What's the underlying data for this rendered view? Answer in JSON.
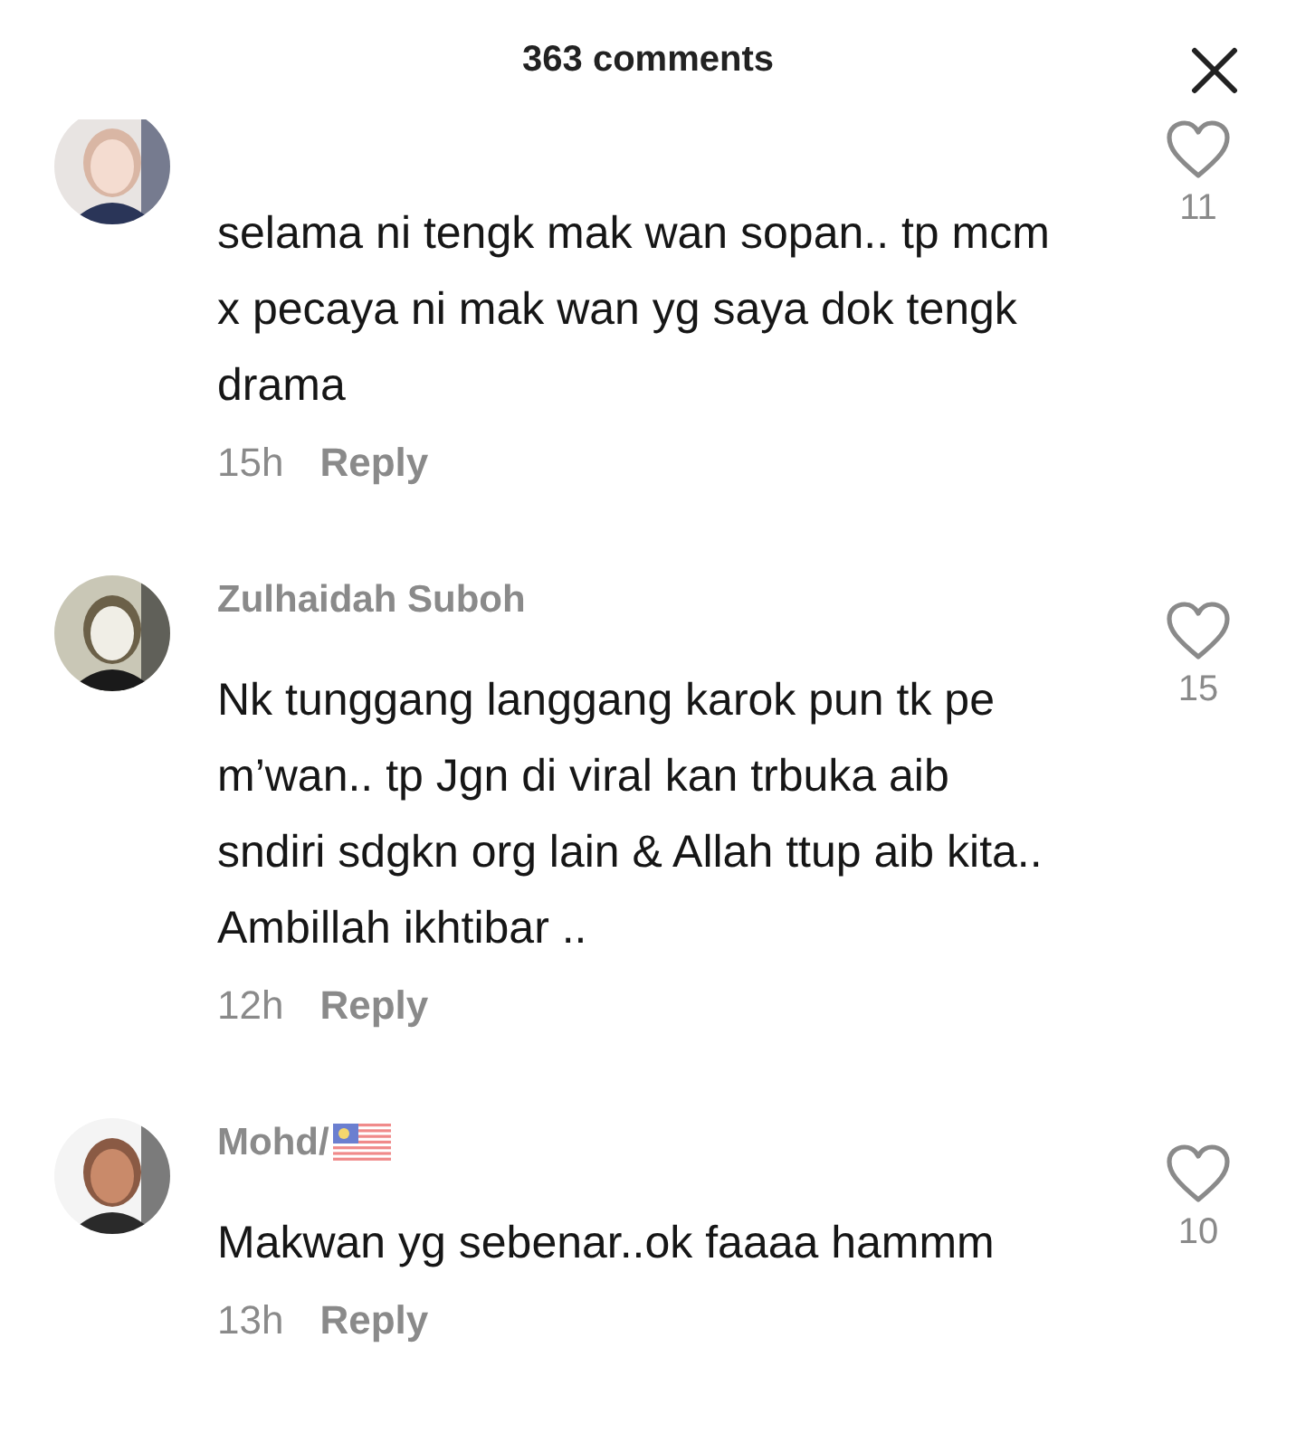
{
  "header": {
    "title": "363 comments"
  },
  "comments": [
    {
      "text": "selama ni tengk mak wan sopan.. tp mcm x pecaya ni mak wan yg saya dok tengk drama",
      "time": "15h",
      "reply": "Reply",
      "likes": "11",
      "flag": false
    },
    {
      "username": "Zulhaidah Suboh",
      "text": "Nk tunggang langgang karok pun tk pe m’wan.. tp Jgn di viral kan trbuka aib sndiri sdgkn org lain & Allah ttup aib kita.. Ambillah ikhtibar ..",
      "time": "12h",
      "reply": "Reply",
      "likes": "15",
      "flag": false
    },
    {
      "username": "Mohd/",
      "text": "Makwan yg sebenar..ok faaaa hammm",
      "time": "13h",
      "reply": "Reply",
      "likes": "10",
      "flag": true
    }
  ]
}
